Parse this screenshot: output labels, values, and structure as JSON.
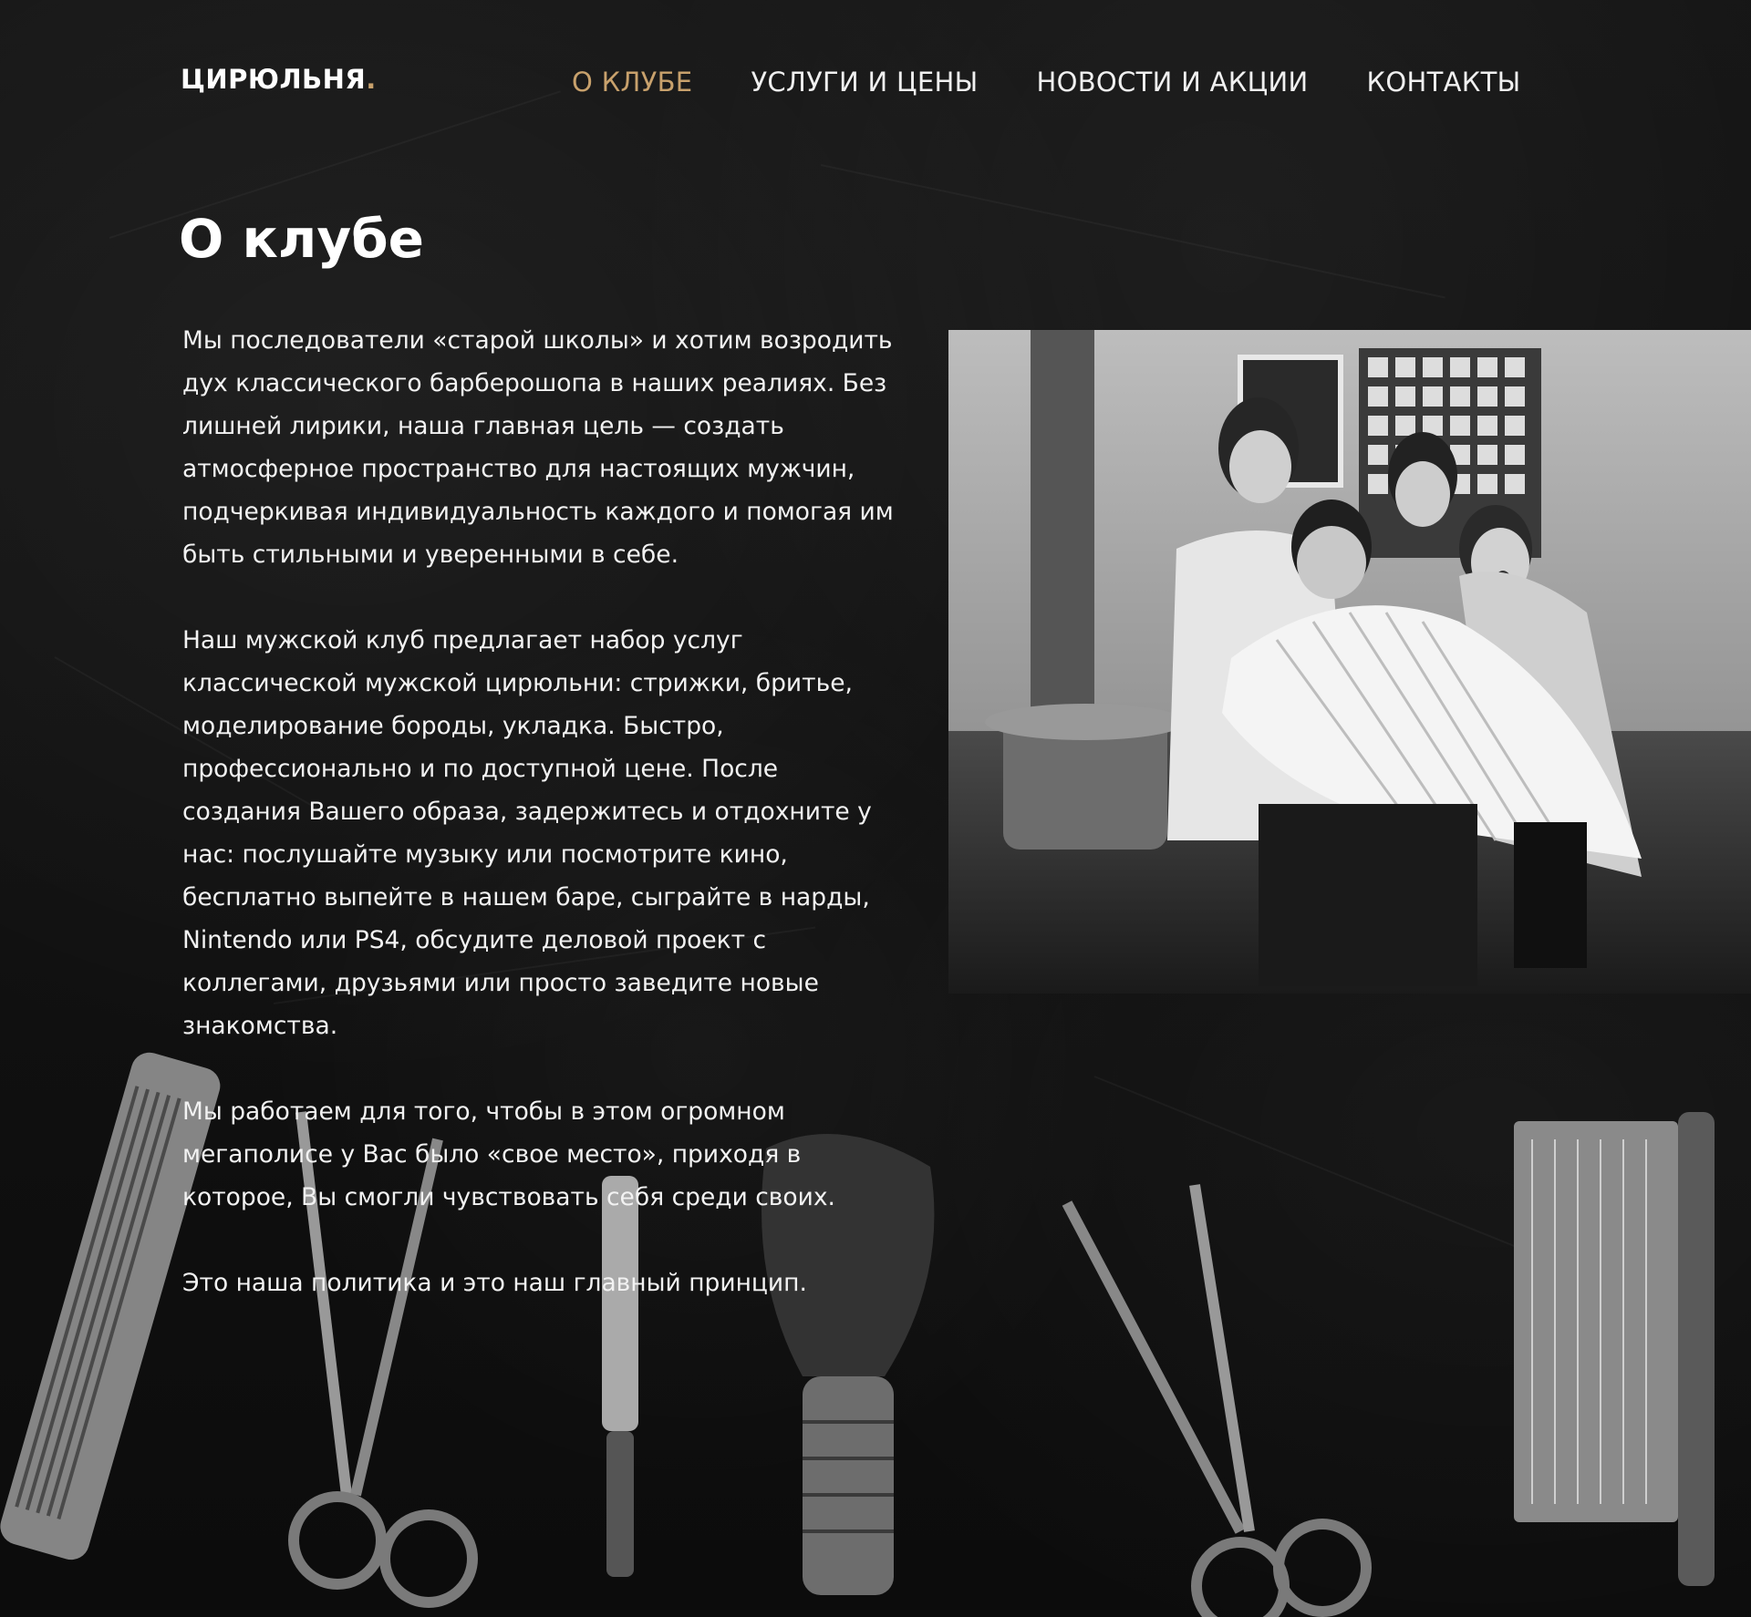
{
  "header": {
    "logo_text": "ЦИРЮЛЬНЯ",
    "logo_dot": ".",
    "nav": [
      {
        "label": "О КЛУБЕ",
        "active": true
      },
      {
        "label": "УСЛУГИ И ЦЕНЫ",
        "active": false
      },
      {
        "label": "НОВОСТИ И АКЦИИ",
        "active": false
      },
      {
        "label": "КОНТАКТЫ",
        "active": false
      }
    ]
  },
  "main": {
    "title": "О клубе",
    "paragraphs": [
      "Мы последователи «старой школы» и хотим возродить дух классического барберошопа в наших реалиях. Без лишней лирики, наша главная цель — создать атмосферное пространство для настоящих мужчин, подчеркивая индивидуальность каждого и помогая им быть стильными и уверенными в себе.",
      "Наш мужской клуб предлагает набор услуг классической мужской цирюльни: стрижки, бритье, моделирование бороды, укладка. Быстро, профессионально и по доступной цене. После создания Вашего образа, задержитесь и отдохните у нас: послушайте музыку или посмотрите кино, бесплатно выпейте в нашем баре, сыграйте в нарды, Nintendo или PS4, обсудите деловой проект с коллегами, друзьями или просто заведите новые знакомства.",
      "Мы работаем для того, чтобы в этом огромном мегаполисе у Вас было «свое место», приходя в которое, Вы смогли чувствовать себя среди своих.",
      "Это наша политика и это наш главный принцип."
    ]
  },
  "colors": {
    "accent": "#c8a16c",
    "background": "#121212",
    "text": "#f2f2f2"
  },
  "icons": [
    "comb-icon",
    "scissors-icon",
    "razor-icon",
    "shaving-brush-icon",
    "duster-brush-icon"
  ]
}
